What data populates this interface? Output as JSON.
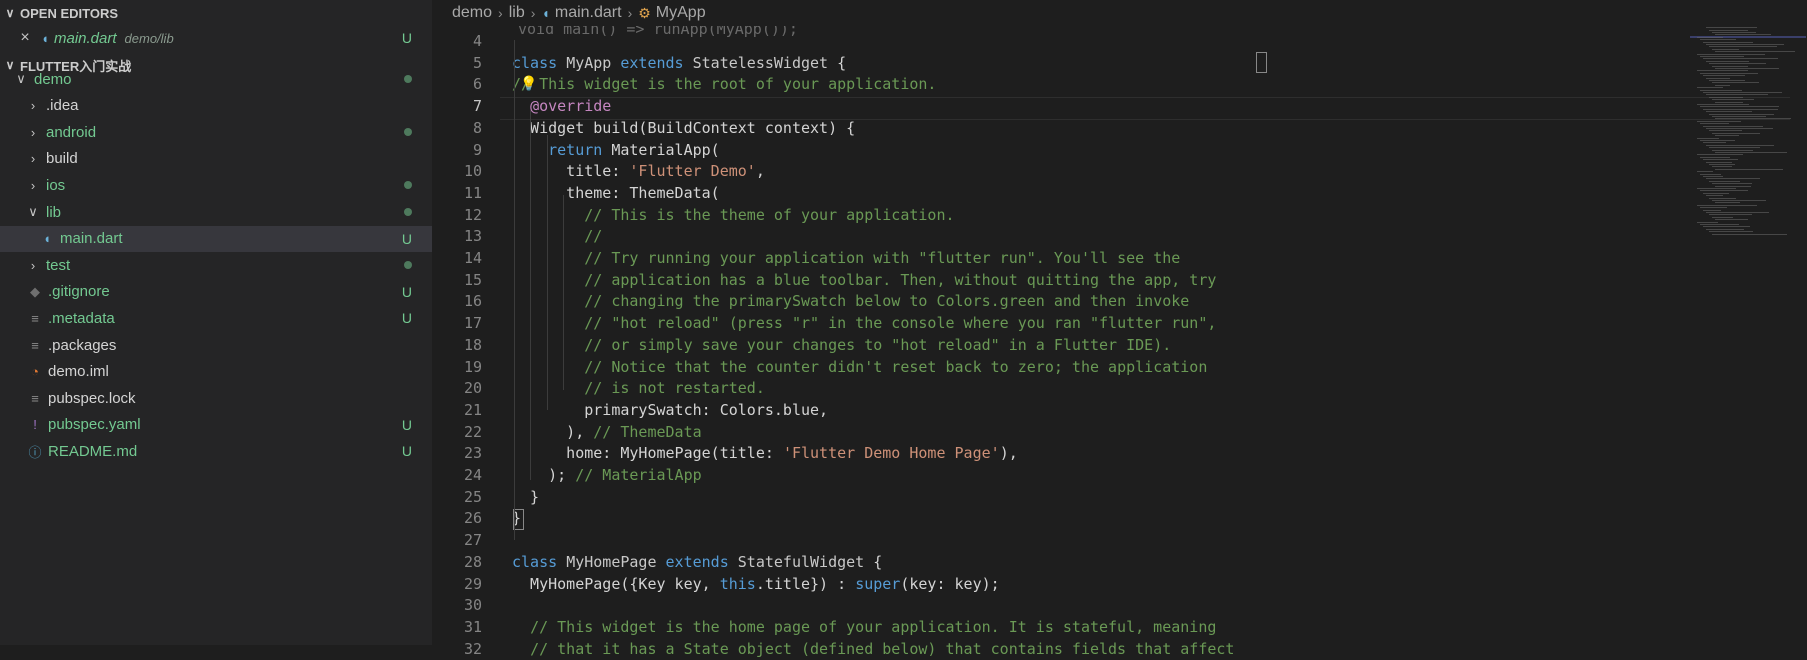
{
  "explorer": {
    "open_editors_label": "OPEN EDITORS",
    "open_editor": {
      "file": "main.dart",
      "path": "demo/lib",
      "badge": "U"
    },
    "project_label": "FLUTTER入门实战",
    "tree": [
      {
        "name": "demo",
        "arrow": "∨",
        "depth": 0,
        "status": "dot",
        "modified": true
      },
      {
        "name": ".idea",
        "arrow": "›",
        "depth": 1,
        "status": "",
        "modified": false
      },
      {
        "name": "android",
        "arrow": "›",
        "depth": 1,
        "status": "dot",
        "modified": true
      },
      {
        "name": "build",
        "arrow": "›",
        "depth": 1,
        "status": "",
        "modified": false
      },
      {
        "name": "ios",
        "arrow": "›",
        "depth": 1,
        "status": "dot",
        "modified": true
      },
      {
        "name": "lib",
        "arrow": "∨",
        "depth": 1,
        "status": "dot",
        "modified": true
      },
      {
        "name": "main.dart",
        "arrow": "",
        "depth": 2,
        "status": "U",
        "modified": true,
        "icon": "dart-icon",
        "selected": true
      },
      {
        "name": "test",
        "arrow": "›",
        "depth": 1,
        "status": "dot",
        "modified": true
      },
      {
        "name": ".gitignore",
        "arrow": "",
        "depth": 1,
        "status": "U",
        "modified": true,
        "icon": "git-icon"
      },
      {
        "name": ".metadata",
        "arrow": "",
        "depth": 1,
        "status": "U",
        "modified": true,
        "icon": "lines-icon"
      },
      {
        "name": ".packages",
        "arrow": "",
        "depth": 1,
        "status": "",
        "modified": false,
        "icon": "lines-icon"
      },
      {
        "name": "demo.iml",
        "arrow": "",
        "depth": 1,
        "status": "",
        "modified": false,
        "icon": "rss-icon"
      },
      {
        "name": "pubspec.lock",
        "arrow": "",
        "depth": 1,
        "status": "",
        "modified": false,
        "icon": "lines-icon"
      },
      {
        "name": "pubspec.yaml",
        "arrow": "",
        "depth": 1,
        "status": "U",
        "modified": true,
        "icon": "exclamation-icon"
      },
      {
        "name": "README.md",
        "arrow": "",
        "depth": 1,
        "status": "U",
        "modified": true,
        "icon": "info-icon"
      }
    ]
  },
  "breadcrumb": [
    "demo",
    "lib",
    "main.dart",
    "MyApp"
  ],
  "peek_text": "void main() => runApp(MyApp());",
  "code_lines": [
    {
      "n": "4",
      "tokens": []
    },
    {
      "n": "5",
      "tokens": [
        [
          "kw",
          "class "
        ],
        [
          "cls",
          "MyApp "
        ],
        [
          "kw",
          "extends "
        ],
        [
          "cls",
          "StatelessWidget "
        ],
        [
          "",
          "{"
        ]
      ]
    },
    {
      "n": "6",
      "tokens": [
        [
          "cm",
          "// This widget is the root of your application."
        ]
      ]
    },
    {
      "n": "7",
      "tokens": [
        [
          "",
          "  "
        ],
        [
          "ann",
          "@override"
        ]
      ]
    },
    {
      "n": "8",
      "tokens": [
        [
          "",
          "  Widget build(BuildContext context) {"
        ]
      ]
    },
    {
      "n": "9",
      "tokens": [
        [
          "",
          "    "
        ],
        [
          "kw",
          "return "
        ],
        [
          "",
          "MaterialApp("
        ]
      ]
    },
    {
      "n": "10",
      "tokens": [
        [
          "",
          "      title: "
        ],
        [
          "str",
          "'Flutter Demo'"
        ],
        [
          "",
          ","
        ]
      ]
    },
    {
      "n": "11",
      "tokens": [
        [
          "",
          "      theme: ThemeData("
        ]
      ]
    },
    {
      "n": "12",
      "tokens": [
        [
          "",
          "        "
        ],
        [
          "cm",
          "// This is the theme of your application."
        ]
      ]
    },
    {
      "n": "13",
      "tokens": [
        [
          "",
          "        "
        ],
        [
          "cm",
          "//"
        ]
      ]
    },
    {
      "n": "14",
      "tokens": [
        [
          "",
          "        "
        ],
        [
          "cm",
          "// Try running your application with \"flutter run\". You'll see the"
        ]
      ]
    },
    {
      "n": "15",
      "tokens": [
        [
          "",
          "        "
        ],
        [
          "cm",
          "// application has a blue toolbar. Then, without quitting the app, try"
        ]
      ]
    },
    {
      "n": "16",
      "tokens": [
        [
          "",
          "        "
        ],
        [
          "cm",
          "// changing the primarySwatch below to Colors.green and then invoke"
        ]
      ]
    },
    {
      "n": "17",
      "tokens": [
        [
          "",
          "        "
        ],
        [
          "cm",
          "// \"hot reload\" (press \"r\" in the console where you ran \"flutter run\","
        ]
      ]
    },
    {
      "n": "18",
      "tokens": [
        [
          "",
          "        "
        ],
        [
          "cm",
          "// or simply save your changes to \"hot reload\" in a Flutter IDE)."
        ]
      ]
    },
    {
      "n": "19",
      "tokens": [
        [
          "",
          "        "
        ],
        [
          "cm",
          "// Notice that the counter didn't reset back to zero; the application"
        ]
      ]
    },
    {
      "n": "20",
      "tokens": [
        [
          "",
          "        "
        ],
        [
          "cm",
          "// is not restarted."
        ]
      ]
    },
    {
      "n": "21",
      "tokens": [
        [
          "",
          "        primarySwatch: Colors.blue,"
        ]
      ]
    },
    {
      "n": "22",
      "tokens": [
        [
          "",
          "      ), "
        ],
        [
          "cm",
          "// ThemeData"
        ]
      ]
    },
    {
      "n": "23",
      "tokens": [
        [
          "",
          "      home: MyHomePage(title: "
        ],
        [
          "str",
          "'Flutter Demo Home Page'"
        ],
        [
          "",
          "),"
        ]
      ]
    },
    {
      "n": "24",
      "tokens": [
        [
          "",
          "    ); "
        ],
        [
          "cm",
          "// MaterialApp"
        ]
      ]
    },
    {
      "n": "25",
      "tokens": [
        [
          "",
          "  }"
        ]
      ]
    },
    {
      "n": "26",
      "tokens": [
        [
          "",
          "}"
        ]
      ]
    },
    {
      "n": "27",
      "tokens": []
    },
    {
      "n": "28",
      "tokens": [
        [
          "kw",
          "class "
        ],
        [
          "cls",
          "MyHomePage "
        ],
        [
          "kw",
          "extends "
        ],
        [
          "cls",
          "StatefulWidget "
        ],
        [
          "",
          "{"
        ]
      ]
    },
    {
      "n": "29",
      "tokens": [
        [
          "",
          "  MyHomePage({Key key, "
        ],
        [
          "kw",
          "this"
        ],
        [
          "",
          ".title}) : "
        ],
        [
          "kw",
          "super"
        ],
        [
          "",
          "(key: key);"
        ]
      ]
    },
    {
      "n": "30",
      "tokens": []
    },
    {
      "n": "31",
      "tokens": [
        [
          "",
          "  "
        ],
        [
          "cm",
          "// This widget is the home page of your application. It is stateful, meaning"
        ]
      ]
    },
    {
      "n": "32",
      "tokens": [
        [
          "",
          "  "
        ],
        [
          "cm",
          "// that it has a State object (defined below) that contains fields that affect"
        ]
      ]
    }
  ],
  "colors": {
    "modified": "#73c991",
    "keyword": "#569cd6",
    "comment": "#6a9955",
    "string": "#ce9178",
    "annotation": "#c586c0"
  }
}
